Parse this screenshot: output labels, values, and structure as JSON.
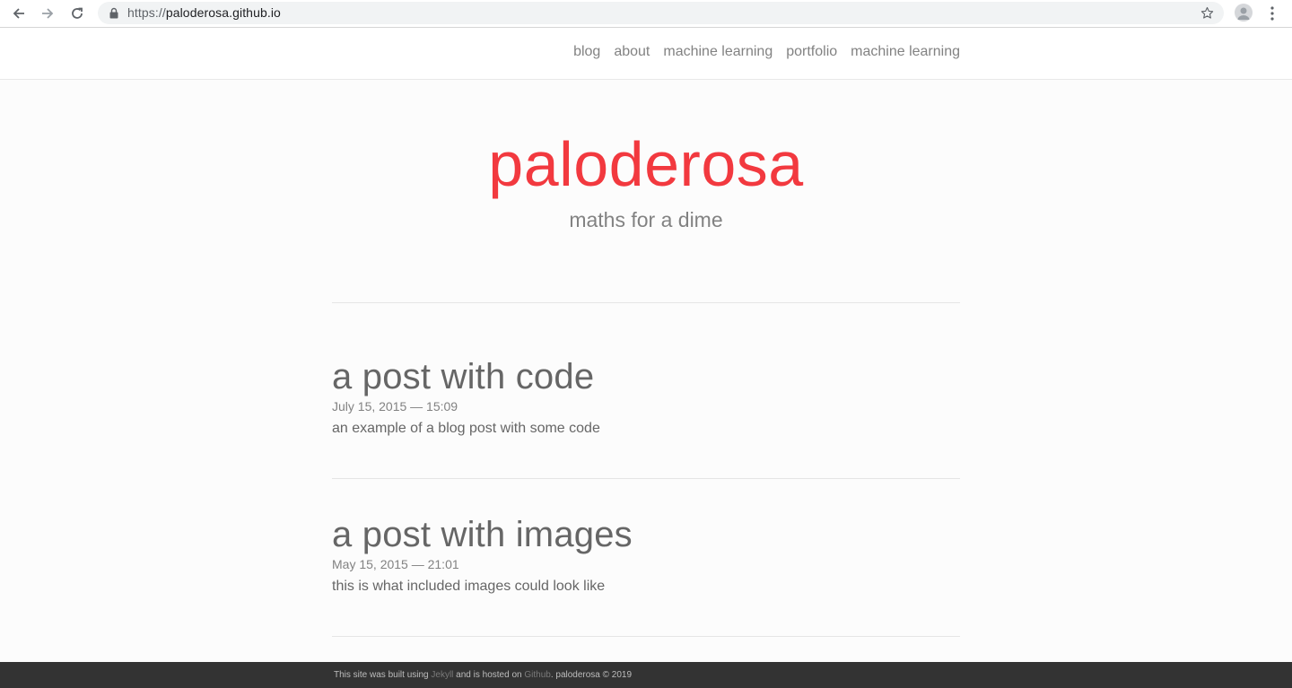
{
  "browser": {
    "url_scheme": "https://",
    "url_host": "paloderosa.github.io",
    "icons": [
      "back-icon",
      "forward-icon",
      "reload-icon",
      "lock-icon",
      "star-icon",
      "profile-icon",
      "menu-icon"
    ]
  },
  "nav": {
    "items": [
      {
        "label": "blog"
      },
      {
        "label": "about"
      },
      {
        "label": "machine learning"
      },
      {
        "label": "portfolio"
      },
      {
        "label": "machine learning"
      }
    ]
  },
  "hero": {
    "title": "paloderosa",
    "subtitle": "maths for a dime"
  },
  "posts": [
    {
      "title": "a post with code",
      "date": "July 15, 2015 — 15:09",
      "description": "an example of a blog post with some code"
    },
    {
      "title": "a post with images",
      "date": "May 15, 2015 — 21:01",
      "description": "this is what included images could look like"
    }
  ],
  "footer": {
    "text_1": "This site was built using ",
    "link_jekyll": "Jekyll",
    "text_2": " and is hosted on ",
    "link_github": "Github",
    "text_3": ". paloderosa © 2019"
  },
  "colors": {
    "accent": "#f2393f",
    "text": "#666666",
    "muted": "#828282",
    "footer_bg": "#333333"
  }
}
